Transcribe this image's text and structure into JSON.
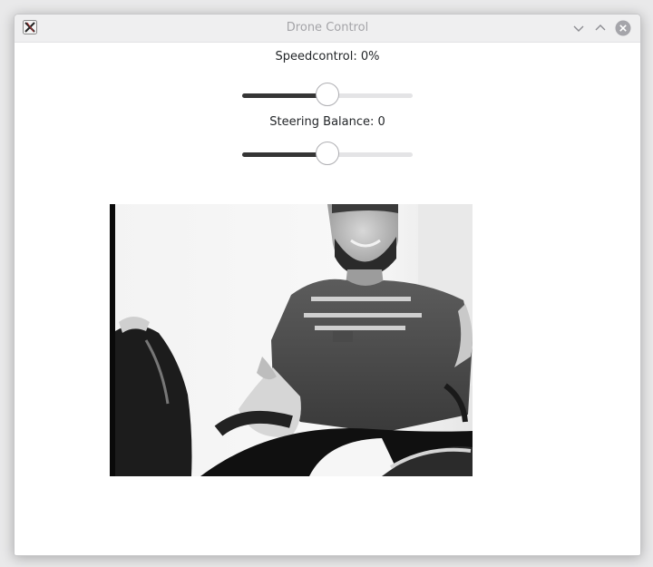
{
  "window": {
    "title": "Drone Control",
    "icon": "x-app-icon"
  },
  "titlebar_buttons": {
    "minimize": "chevron-down-icon",
    "maximize": "chevron-up-icon",
    "close": "close-circle-icon"
  },
  "controls": {
    "speed": {
      "label": "Speedcontrol: 0%",
      "level": 0.5
    },
    "steering": {
      "label": "Steering Balance: 0",
      "level": 0.5
    }
  },
  "camera": {
    "feed": "grayscale-webcam-image",
    "shirt_text": [
      "\u0016\u0016\u0016\u0016\u0016\u0016\u0016\u0016",
      "\u0016\u0016\u0016\u0016 \u0016\u0016\u0016",
      "\u0016\u0016\u0016\u0016\u0016\u0016"
    ]
  },
  "colors": {
    "slider_fill": "#353535",
    "slider_track": "#e4e4e6",
    "titlebar": "#efeff0"
  }
}
